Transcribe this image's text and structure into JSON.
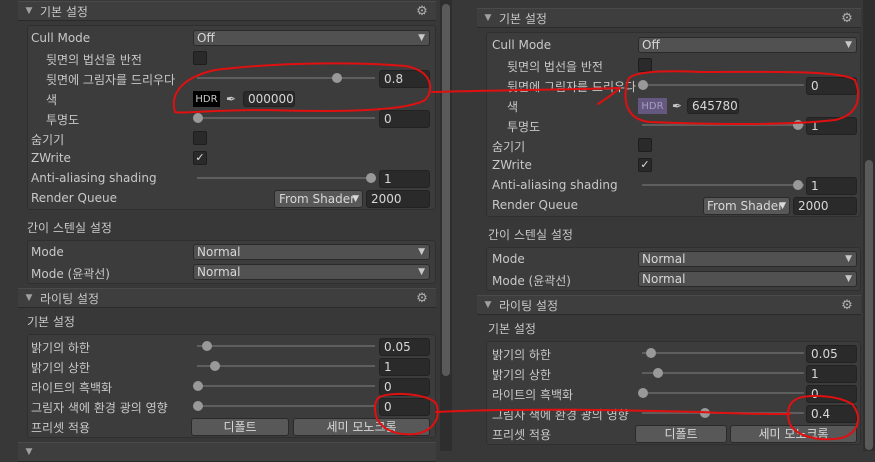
{
  "colors": {
    "annotation": "#e01010",
    "hdr_left_bg": "#000000",
    "hdr_right_bg": "#645780"
  },
  "left": {
    "basic_section": "기본 설정",
    "cull_mode_label": "Cull Mode",
    "cull_mode_value": "Off",
    "flip_normal_label": "뒷면의 법선을 반전",
    "backface_shadow_label": "뒷면에 그림자를 드리우다",
    "backface_shadow_value": "0.8",
    "color_label": "색",
    "hdr_text": "HDR",
    "color_hex": "000000",
    "transparency_label": "투명도",
    "transparency_value": "0",
    "hide_label": "숨기기",
    "zwrite_label": "ZWrite",
    "aa_label": "Anti-aliasing shading",
    "aa_value": "1",
    "render_queue_label": "Render Queue",
    "render_queue_dropdown": "From Shader",
    "render_queue_value": "2000",
    "stencil_head": "간이 스텐실 설정",
    "mode_label": "Mode",
    "mode_value": "Normal",
    "mode_outline_label": "Mode (윤곽선)",
    "mode_outline_value": "Normal",
    "lighting_section": "라이팅 설정",
    "lighting_basic_head": "기본 설정",
    "brightness_min_label": "밝기의 하한",
    "brightness_min_value": "0.05",
    "brightness_max_label": "밝기의 상한",
    "brightness_max_value": "1",
    "mono_label": "라이트의 흑백화",
    "mono_value": "0",
    "env_shadow_label": "그림자 색에 환경 광의 영향",
    "env_shadow_value": "0",
    "preset_label": "프리셋 적용",
    "default_btn": "디폴트",
    "semi_mono_btn": "세미 모노크롬",
    "progress": {
      "backface_shadow": 0.8,
      "transparency": 0.0,
      "aa": 1.0,
      "brightness_min": 0.05,
      "brightness_max": 0.1,
      "mono": 0.0,
      "env_shadow": 0.0
    }
  },
  "right": {
    "basic_section": "기본 설정",
    "cull_mode_label": "Cull Mode",
    "cull_mode_value": "Off",
    "flip_normal_label": "뒷면의 법선을 반전",
    "backface_shadow_label": "뒷면에 그림자를 드리우다",
    "backface_shadow_value": "0",
    "color_label": "색",
    "hdr_text": "HDR",
    "color_hex": "645780",
    "transparency_label": "투명도",
    "transparency_value": "1",
    "hide_label": "숨기기",
    "zwrite_label": "ZWrite",
    "aa_label": "Anti-aliasing shading",
    "aa_value": "1",
    "render_queue_label": "Render Queue",
    "render_queue_dropdown": "From Shader",
    "render_queue_value": "2000",
    "stencil_head": "간이 스텐실 설정",
    "mode_label": "Mode",
    "mode_value": "Normal",
    "mode_outline_label": "Mode (윤곽선)",
    "mode_outline_value": "Normal",
    "lighting_section": "라이팅 설정",
    "lighting_basic_head": "기본 설정",
    "brightness_min_label": "밝기의 하한",
    "brightness_min_value": "0.05",
    "brightness_max_label": "밝기의 상한",
    "brightness_max_value": "1",
    "mono_label": "라이트의 흑백화",
    "mono_value": "0",
    "env_shadow_label": "그림자 색에 환경 광의 영향",
    "env_shadow_value": "0.4",
    "preset_label": "프리셋 적용",
    "default_btn": "디폴트",
    "semi_mono_btn": "세미 모노크롬",
    "progress": {
      "backface_shadow": 0.0,
      "transparency": 1.0,
      "aa": 1.0,
      "brightness_min": 0.05,
      "brightness_max": 0.1,
      "mono": 0.0,
      "env_shadow": 0.4
    }
  }
}
